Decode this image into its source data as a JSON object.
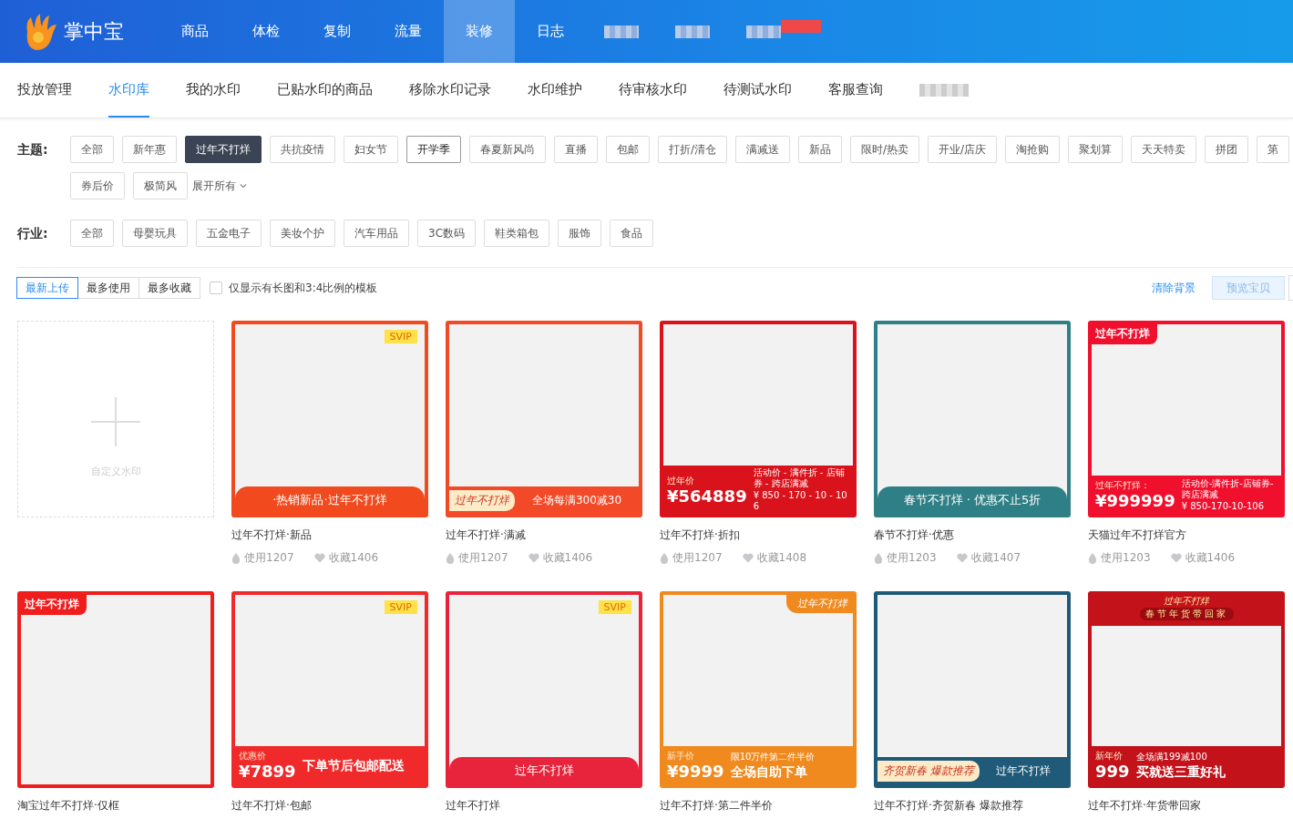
{
  "app": {
    "name": "掌中宝"
  },
  "top_menu": [
    {
      "label": "商品",
      "selected": false
    },
    {
      "label": "体检",
      "selected": false
    },
    {
      "label": "复制",
      "selected": false
    },
    {
      "label": "流量",
      "selected": false
    },
    {
      "label": "装修",
      "selected": true
    },
    {
      "label": "日志",
      "selected": false
    }
  ],
  "sub_nav": [
    {
      "label": "投放管理",
      "selected": false
    },
    {
      "label": "水印库",
      "selected": true
    },
    {
      "label": "我的水印",
      "selected": false
    },
    {
      "label": "已贴水印的商品",
      "selected": false
    },
    {
      "label": "移除水印记录",
      "selected": false
    },
    {
      "label": "水印维护",
      "selected": false
    },
    {
      "label": "待审核水印",
      "selected": false
    },
    {
      "label": "待测试水印",
      "selected": false
    },
    {
      "label": "客服查询",
      "selected": false
    }
  ],
  "filters": [
    {
      "label": "主题:",
      "tags": [
        {
          "label": "全部",
          "selected": false,
          "hovered": false
        },
        {
          "label": "新年惠",
          "selected": false,
          "hovered": false
        },
        {
          "label": "过年不打烊",
          "selected": true,
          "hovered": false
        },
        {
          "label": "共抗疫情",
          "selected": false,
          "hovered": false
        },
        {
          "label": "妇女节",
          "selected": false,
          "hovered": false
        },
        {
          "label": "开学季",
          "selected": false,
          "hovered": true
        },
        {
          "label": "春夏新风尚",
          "selected": false,
          "hovered": false
        },
        {
          "label": "直播",
          "selected": false,
          "hovered": false
        },
        {
          "label": "包邮",
          "selected": false,
          "hovered": false
        },
        {
          "label": "打折/清仓",
          "selected": false,
          "hovered": false
        },
        {
          "label": "满减送",
          "selected": false,
          "hovered": false
        },
        {
          "label": "新品",
          "selected": false,
          "hovered": false
        },
        {
          "label": "限时/热卖",
          "selected": false,
          "hovered": false
        },
        {
          "label": "开业/店庆",
          "selected": false,
          "hovered": false
        },
        {
          "label": "淘抢购",
          "selected": false,
          "hovered": false
        },
        {
          "label": "聚划算",
          "selected": false,
          "hovered": false
        },
        {
          "label": "天天特卖",
          "selected": false,
          "hovered": false
        },
        {
          "label": "拼团",
          "selected": false,
          "hovered": false
        },
        {
          "label": "第",
          "selected": false,
          "hovered": false
        },
        {
          "label": "券后价",
          "selected": false,
          "hovered": false
        },
        {
          "label": "极简风",
          "selected": false,
          "hovered": false
        }
      ],
      "expand": "展开所有"
    },
    {
      "label": "行业:",
      "tags": [
        {
          "label": "全部",
          "selected": false,
          "hovered": false
        },
        {
          "label": "母婴玩具",
          "selected": false,
          "hovered": false
        },
        {
          "label": "五金电子",
          "selected": false,
          "hovered": false
        },
        {
          "label": "美妆个护",
          "selected": false,
          "hovered": false
        },
        {
          "label": "汽车用品",
          "selected": false,
          "hovered": false
        },
        {
          "label": "3C数码",
          "selected": false,
          "hovered": false
        },
        {
          "label": "鞋类箱包",
          "selected": false,
          "hovered": false
        },
        {
          "label": "服饰",
          "selected": false,
          "hovered": false
        },
        {
          "label": "食品",
          "selected": false,
          "hovered": false
        }
      ]
    }
  ],
  "sort": [
    {
      "label": "最新上传",
      "selected": true
    },
    {
      "label": "最多使用",
      "selected": false
    },
    {
      "label": "最多收藏",
      "selected": false
    }
  ],
  "long_image_only": {
    "label": "仅显示有长图和3:4比例的模板",
    "checked": false
  },
  "clear_background": "清除背景",
  "preview_button": "预览宝贝",
  "custom_card": {
    "label": "自定义水印"
  },
  "templates": [
    {
      "title": "过年不打烊·新品",
      "color": "#f04a1e",
      "kind": "banner",
      "badge": "SVIP",
      "texts": [
        "·热销新品·过年不打烊"
      ],
      "uses": "使用1207",
      "favs": "收藏1406"
    },
    {
      "title": "过年不打烊·满减",
      "color": "#f24a28",
      "kind": "split",
      "texts": [
        "过年不打烊",
        "全场每满300减30"
      ],
      "uses": "使用1207",
      "favs": "收藏1406"
    },
    {
      "title": "过年不打烊·折扣",
      "color": "#d9121b",
      "kind": "price",
      "price_label": "过年价",
      "price": "¥564889",
      "texts": [
        "活动价 - 满件折 - 店铺券 - 跨店满减",
        "¥ 850 - 170 - 10 - 106"
      ],
      "uses": "使用1207",
      "favs": "收藏1408"
    },
    {
      "title": "春节不打烊·优惠",
      "color": "#2f7f86",
      "kind": "banner",
      "texts": [
        "春节不打烊 · 优惠不止5折"
      ],
      "uses": "使用1203",
      "favs": "收藏1407"
    },
    {
      "title": "天猫过年不打烊官方",
      "color": "#f0102e",
      "kind": "price",
      "tag": "过年不打烊",
      "price_label": "过年不打烊：",
      "price": "¥999999",
      "texts": [
        "活动价-满件折-店铺券-跨店满减",
        "¥ 850-170-10-106"
      ],
      "uses": "使用1203",
      "favs": "收藏1406"
    },
    {
      "title": "淘宝过年不打烊·仅框",
      "color": "#f01d1d",
      "kind": "frame",
      "tag": "过年不打烊"
    },
    {
      "title": "过年不打烊·包邮",
      "color": "#f02a2a",
      "kind": "price",
      "badge": "SVIP",
      "price_label": "优惠价",
      "price": "¥7899",
      "texts": [
        "下单节后包邮配送"
      ]
    },
    {
      "title": "过年不打烊",
      "color": "#e8243c",
      "kind": "banner",
      "badge": "SVIP",
      "texts": [
        "过年不打烊"
      ]
    },
    {
      "title": "过年不打烊·第二件半价",
      "color": "#f08a1e",
      "kind": "price",
      "corner": "过年不打烊",
      "price_label": "新手价",
      "price": "¥9999",
      "texts": [
        "限10万件第二件半价",
        "全场自助下单"
      ]
    },
    {
      "title": "过年不打烊·齐贺新春 爆款推荐",
      "color": "#1f5a78",
      "kind": "split",
      "texts": [
        "齐贺新春 爆款推荐",
        "过年不打烊"
      ]
    },
    {
      "title": "过年不打烊·年货带回家",
      "color": "#c4121a",
      "kind": "price",
      "header": [
        "过年不打烊",
        "春节年货带回家"
      ],
      "price_label": "新年价",
      "price": "999",
      "texts": [
        "全场满199减100",
        "买就送三重好礼"
      ]
    }
  ]
}
